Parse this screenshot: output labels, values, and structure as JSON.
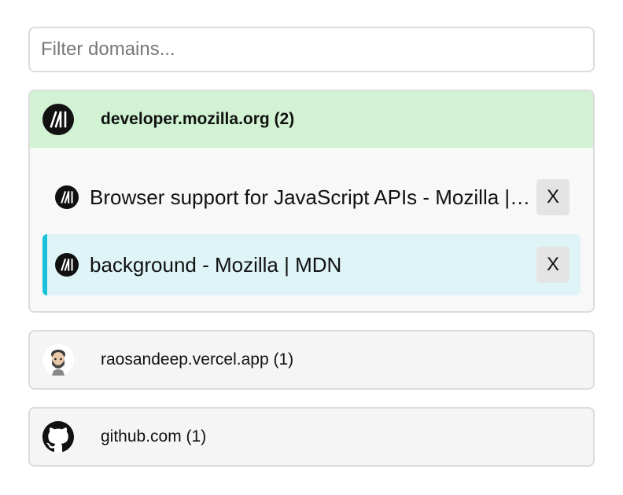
{
  "filter": {
    "placeholder": "Filter domains...",
    "value": ""
  },
  "groups": [
    {
      "label": "developer.mozilla.org (2)",
      "icon": "mdn-logo-icon",
      "expanded": true,
      "tabs": [
        {
          "title": "Browser support for JavaScript APIs - Mozilla | MDN",
          "close_label": "X",
          "active": false
        },
        {
          "title": "background - Mozilla | MDN",
          "close_label": "X",
          "active": true
        }
      ]
    },
    {
      "label": "raosandeep.vercel.app (1)",
      "icon": "avatar-icon",
      "expanded": false
    },
    {
      "label": "github.com (1)",
      "icon": "github-icon",
      "expanded": false
    }
  ],
  "colors": {
    "expanded_header": "#d1f2d3",
    "active_tab": "#def4f7",
    "active_accent": "#19c2d8"
  }
}
